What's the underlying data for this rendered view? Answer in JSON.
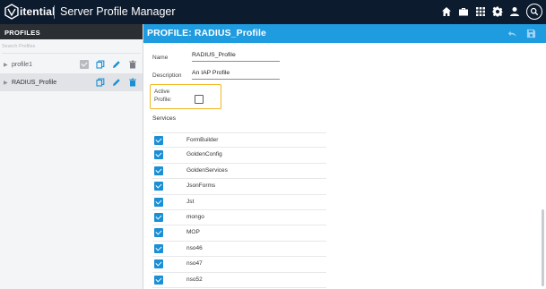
{
  "topbar": {
    "brand": "itential",
    "title": "Server Profile Manager",
    "icons": [
      "home-icon",
      "briefcase-icon",
      "apps-grid-icon",
      "gear-icon",
      "user-icon",
      "search-icon"
    ]
  },
  "sidebar": {
    "header": "PROFILES",
    "search_placeholder": "Search Profiles",
    "items": [
      {
        "label": "profile1",
        "selected": false,
        "active": true
      },
      {
        "label": "RADIUS_Profile",
        "selected": true,
        "active": false
      }
    ]
  },
  "main": {
    "title": "PROFILE: RADIUS_Profile",
    "header_icons": [
      "undo-icon",
      "save-icon"
    ],
    "name_label": "Name",
    "name_value": "RADIUS_Profile",
    "description_label": "Description",
    "description_value": "An IAP Profile",
    "active_label_line1": "Active",
    "active_label_line2": "Profile:",
    "active_checked": false,
    "services_label": "Services",
    "services": [
      {
        "name": "FormBuilder",
        "checked": true
      },
      {
        "name": "GoldenConfig",
        "checked": true
      },
      {
        "name": "GoldenServices",
        "checked": true
      },
      {
        "name": "JsonForms",
        "checked": true
      },
      {
        "name": "Jst",
        "checked": true
      },
      {
        "name": "mongo",
        "checked": true
      },
      {
        "name": "MOP",
        "checked": true
      },
      {
        "name": "nso46",
        "checked": true
      },
      {
        "name": "nso47",
        "checked": true
      },
      {
        "name": "nso52",
        "checked": true
      }
    ]
  },
  "colors": {
    "topbar_bg": "#0d1b2e",
    "header_blue": "#1f9be0",
    "check_blue": "#1a8fd5",
    "highlight_yellow": "#f1b520"
  }
}
